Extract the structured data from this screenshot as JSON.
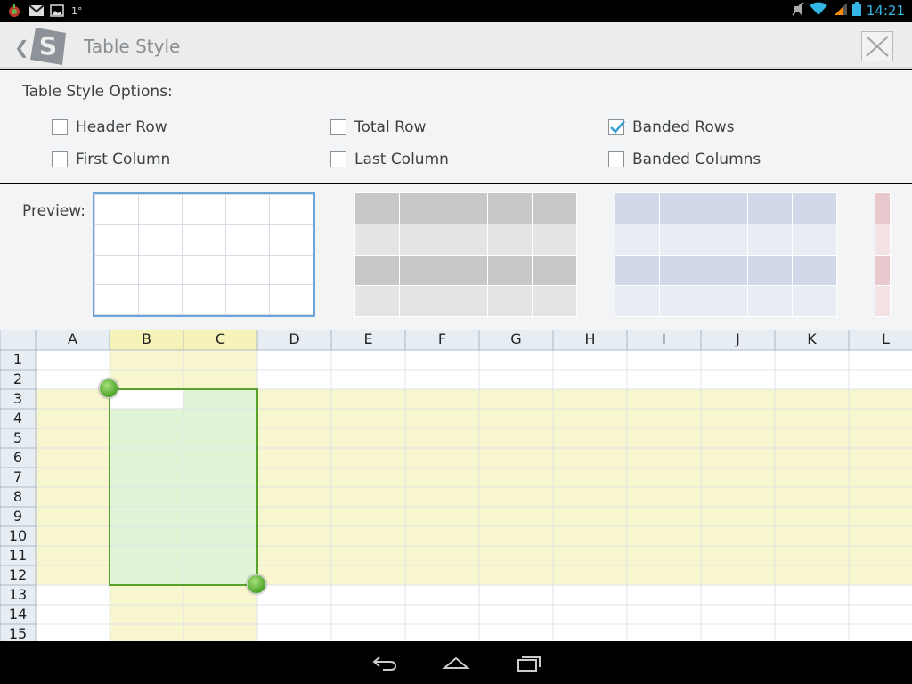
{
  "status_bar": {
    "left_icons": [
      "app-notification-icon",
      "gmail-icon",
      "gallery-icon"
    ],
    "notif_text": "1°",
    "right_icons": [
      "mute-icon",
      "wifi-icon",
      "signal-icon",
      "battery-icon"
    ],
    "time": "14:21"
  },
  "title_bar": {
    "title": "Table Style",
    "logo_letter": "S"
  },
  "options": {
    "heading": "Table Style Options:",
    "items": [
      {
        "label": "Header Row",
        "checked": false
      },
      {
        "label": "Total Row",
        "checked": false
      },
      {
        "label": "Banded Rows",
        "checked": true
      },
      {
        "label": "First Column",
        "checked": false
      },
      {
        "label": "Last Column",
        "checked": false
      },
      {
        "label": "Banded Columns",
        "checked": false
      }
    ]
  },
  "preview": {
    "label": "Preview:",
    "styles": [
      "plain",
      "gray",
      "blue",
      "red"
    ],
    "selected_index": 0
  },
  "sheet": {
    "columns": [
      "A",
      "B",
      "C",
      "D",
      "E",
      "F",
      "G",
      "H",
      "I",
      "J",
      "K",
      "L"
    ],
    "rows": [
      "1",
      "2",
      "3",
      "4",
      "5",
      "6",
      "7",
      "8",
      "9",
      "10",
      "11",
      "12",
      "13",
      "14",
      "15"
    ],
    "highlight_columns": [
      "B",
      "C"
    ],
    "highlight_rows": [
      "3",
      "12"
    ],
    "selection": {
      "from": "B3",
      "to": "C12"
    },
    "colors": {
      "header_bg": "#e6edf3",
      "header_selected_bg": "#f5f3b8",
      "band_yellow": "#f7f6cf",
      "selection_fill": "#e2f4d8",
      "selection_border": "#5aa02c",
      "grid": "#dfe3e6"
    }
  },
  "nav_bar": {
    "icons": [
      "back-icon",
      "home-icon",
      "recent-apps-icon"
    ]
  }
}
